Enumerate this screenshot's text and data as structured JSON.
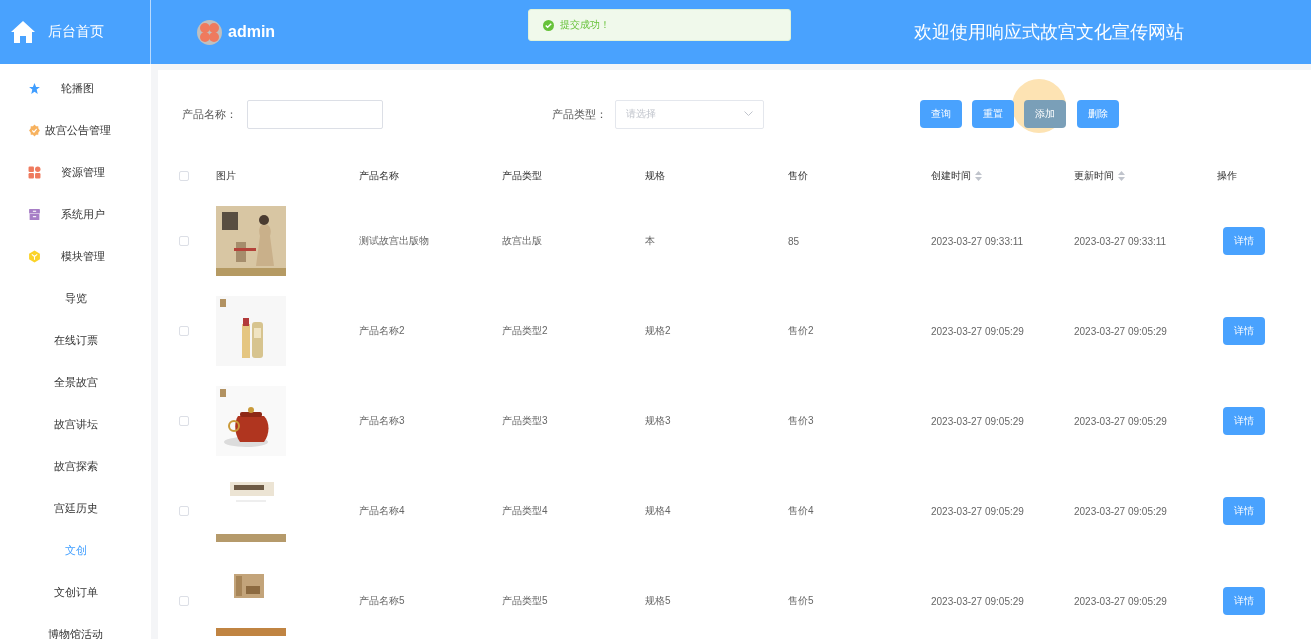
{
  "header": {
    "home_label": "后台首页",
    "user": "admin",
    "title": "欢迎使用响应式故宫文化宣传网站"
  },
  "toast": {
    "kind": "success",
    "message": "提交成功！"
  },
  "sidebar": {
    "items": [
      {
        "label": "轮播图",
        "selected": false
      },
      {
        "label": "故宫公告管理",
        "selected": false
      },
      {
        "label": "资源管理",
        "selected": false
      },
      {
        "label": "系统用户",
        "selected": false
      },
      {
        "label": "模块管理",
        "selected": false,
        "children": [
          {
            "label": "导览",
            "selected": false
          },
          {
            "label": "在线订票",
            "selected": false
          },
          {
            "label": "全景故宫",
            "selected": false
          },
          {
            "label": "故宫讲坛",
            "selected": false
          },
          {
            "label": "故宫探索",
            "selected": false
          },
          {
            "label": "宫廷历史",
            "selected": false
          },
          {
            "label": "文创",
            "selected": true
          },
          {
            "label": "文创订单",
            "selected": false
          },
          {
            "label": "博物馆活动",
            "selected": false
          }
        ]
      }
    ]
  },
  "filters": {
    "name_label": "产品名称：",
    "type_label": "产品类型：",
    "type_placeholder": "请选择"
  },
  "buttons": [
    {
      "label": "查询",
      "hovered": false
    },
    {
      "label": "重置",
      "hovered": false
    },
    {
      "label": "添加",
      "hovered": true
    },
    {
      "label": "删除",
      "hovered": false
    }
  ],
  "table": {
    "header_checked": false,
    "columns": [
      {
        "label": "图片",
        "sortable": false
      },
      {
        "label": "产品名称",
        "sortable": false
      },
      {
        "label": "产品类型",
        "sortable": false
      },
      {
        "label": "规格",
        "sortable": false
      },
      {
        "label": "售价",
        "sortable": false
      },
      {
        "label": "创建时间",
        "sortable": true
      },
      {
        "label": "更新时间",
        "sortable": true
      },
      {
        "label": "操作",
        "sortable": false
      }
    ],
    "rows": [
      {
        "checked": false,
        "cells": [
          {
            "kind": "picture"
          },
          "测试故宫出版物",
          "故宫出版",
          "本",
          "85",
          "2023-03-27 09:33:11",
          "2023-03-27 09:33:11",
          {
            "kind": "button",
            "label": "详情"
          }
        ]
      },
      {
        "checked": false,
        "cells": [
          {
            "kind": "picture"
          },
          "产品名称2",
          "产品类型2",
          "规格2",
          "售价2",
          "2023-03-27 09:05:29",
          "2023-03-27 09:05:29",
          {
            "kind": "button",
            "label": "详情"
          }
        ]
      },
      {
        "checked": false,
        "cells": [
          {
            "kind": "picture"
          },
          "产品名称3",
          "产品类型3",
          "规格3",
          "售价3",
          "2023-03-27 09:05:29",
          "2023-03-27 09:05:29",
          {
            "kind": "button",
            "label": "详情"
          }
        ]
      },
      {
        "checked": false,
        "cells": [
          {
            "kind": "picture"
          },
          "产品名称4",
          "产品类型4",
          "规格4",
          "售价4",
          "2023-03-27 09:05:29",
          "2023-03-27 09:05:29",
          {
            "kind": "button",
            "label": "详情"
          }
        ]
      },
      {
        "checked": false,
        "cells": [
          {
            "kind": "picture"
          },
          "产品名称5",
          "产品类型5",
          "规格5",
          "售价5",
          "2023-03-27 09:05:29",
          "2023-03-27 09:05:29",
          {
            "kind": "button",
            "label": "详情"
          }
        ]
      }
    ]
  }
}
